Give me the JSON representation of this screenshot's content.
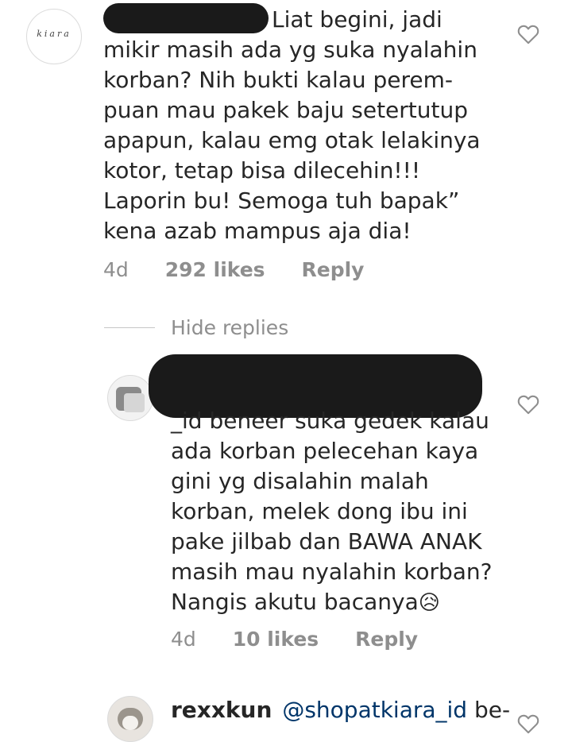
{
  "comment1": {
    "avatar_text": "kiara",
    "first_line": "Liat begini, jadi",
    "lines": [
      "mikir masih ada yg suka nyalahin",
      "korban? Nih bukti kalau perem-",
      "puan mau pakek baju setertutup",
      "apapun, kalau emg otak lelakinya",
      "kotor, tetap bisa dilecehin!!!",
      "Laporin bu! Semoga tuh bapak”",
      "kena azab mampus aja dia!"
    ],
    "time": "4d",
    "likes": "292 likes",
    "reply": "Reply"
  },
  "hide_replies": "Hide replies",
  "reply1": {
    "first_line": "_id beneer suka gedek kalau",
    "lines": [
      "ada korban pelecehan kaya",
      "gini yg disalahin malah",
      "korban, melek dong ibu ini",
      "pake jilbab dan BAWA ANAK",
      "masih mau nyalahin korban?",
      "Nangis akutu bacanya"
    ],
    "emoji": "😥",
    "time": "4d",
    "likes": "10 likes",
    "reply": "Reply"
  },
  "reply2": {
    "username": "rexxkun",
    "mention": "@shopatkiara_id",
    "text": "be-"
  },
  "colors": {
    "text": "#262626",
    "meta": "#8e8e8e",
    "mention": "#003569",
    "redaction": "#1a1a1a"
  },
  "icons": [
    "heart-icon"
  ]
}
